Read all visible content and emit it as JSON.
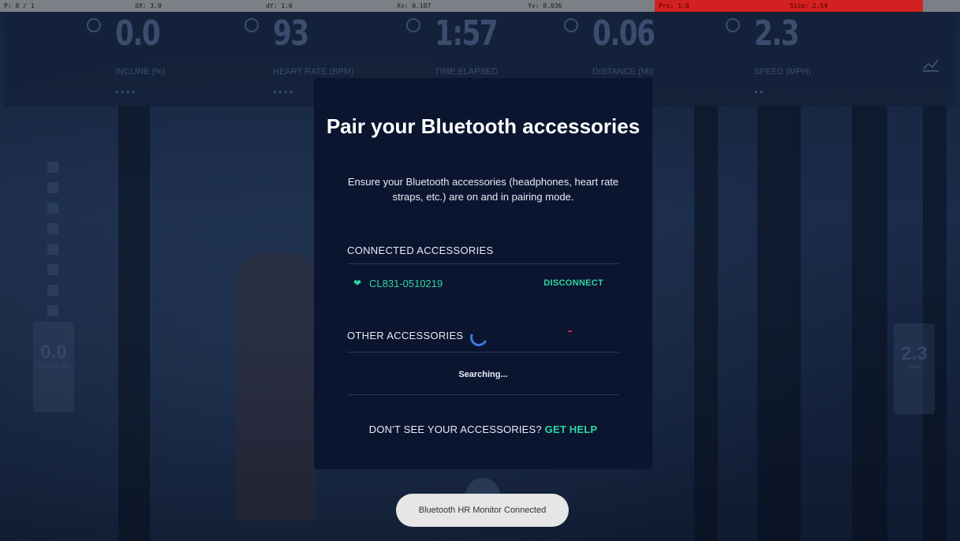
{
  "debug": {
    "p": "P: 0 / 1",
    "dx": "dX: 3.0",
    "dy": "dY: 1.0",
    "xv": "Xv: 0.107",
    "yv": "Yv: 0.036",
    "prs": "Prs: 1.0",
    "size": "Size: 2.54"
  },
  "stats": [
    {
      "value": "0.0",
      "label": "INCLINE (%)",
      "dots": "●●●●"
    },
    {
      "value": "93",
      "label": "HEART RATE (BPM)",
      "dots": "●●●●"
    },
    {
      "value": "1:57",
      "label": "TIME ELAPSED",
      "dots": ""
    },
    {
      "value": "0.06",
      "label": "DISTANCE (MI)",
      "dots": ""
    },
    {
      "value": "2.3",
      "label": "SPEED (MPH)",
      "dots": "●●"
    }
  ],
  "side": {
    "left_value": "0.0",
    "left_label": "INCLINE (%)",
    "right_value": "2.3",
    "right_label": "MPH"
  },
  "modal": {
    "title": "Pair your Bluetooth accessories",
    "description": "Ensure your Bluetooth accessories (headphones, heart rate straps, etc.) are on and in pairing mode.",
    "connected_title": "CONNECTED ACCESSORIES",
    "device_name": "CL831-0510219",
    "disconnect_label": "DISCONNECT",
    "other_title": "OTHER ACCESSORIES",
    "searching": "Searching...",
    "help_text": "DON'T SEE YOUR ACCESSORIES?",
    "help_link": "GET HELP"
  },
  "toast": "Bluetooth HR Monitor Connected",
  "colors": {
    "accent": "#2fd6a3",
    "modal_bg": "#0b1530",
    "spinner": "#3b7be0"
  }
}
